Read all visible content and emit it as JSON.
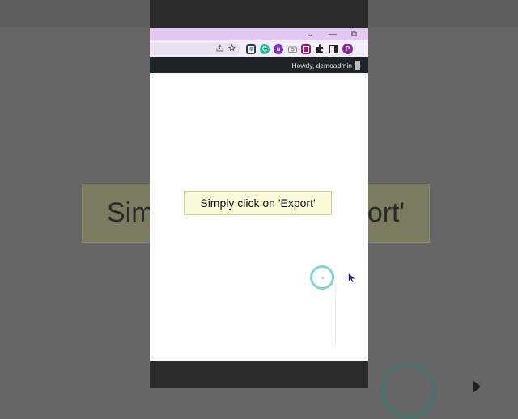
{
  "browser": {
    "tabbar_controls": [
      "⌄",
      "—",
      "⧉"
    ],
    "extensions": [
      {
        "icon": "screen-recorder-icon",
        "color": "#3b3b3b"
      },
      {
        "icon": "grammarly-icon",
        "color": "#15c39a",
        "glyph": "G"
      },
      {
        "icon": "purple-extension-icon",
        "color": "#7a2bd1",
        "glyph": "u"
      },
      {
        "icon": "camera-icon",
        "color": "#8a8a8a"
      },
      {
        "icon": "magenta-extension-icon",
        "color": "#9b1c6e"
      },
      {
        "icon": "puzzle-icon",
        "color": "#222222"
      },
      {
        "icon": "side-panel-icon",
        "color": "#222222"
      },
      {
        "icon": "profile-avatar-icon",
        "color": "#8e2aa8",
        "glyph": "P"
      }
    ]
  },
  "wp_admin_bar": {
    "greeting": "Howdy, demoadmin"
  },
  "caption": {
    "text": "Simply click on 'Export'"
  },
  "background_blur": {
    "caption_left": "Sim",
    "caption_right": "ort'"
  },
  "colors": {
    "click_ring": "#7ed8cf",
    "caption_bg": "#fbfbd9",
    "tabbar": "#e4c9f2",
    "wp_bar": "#1d2327"
  }
}
